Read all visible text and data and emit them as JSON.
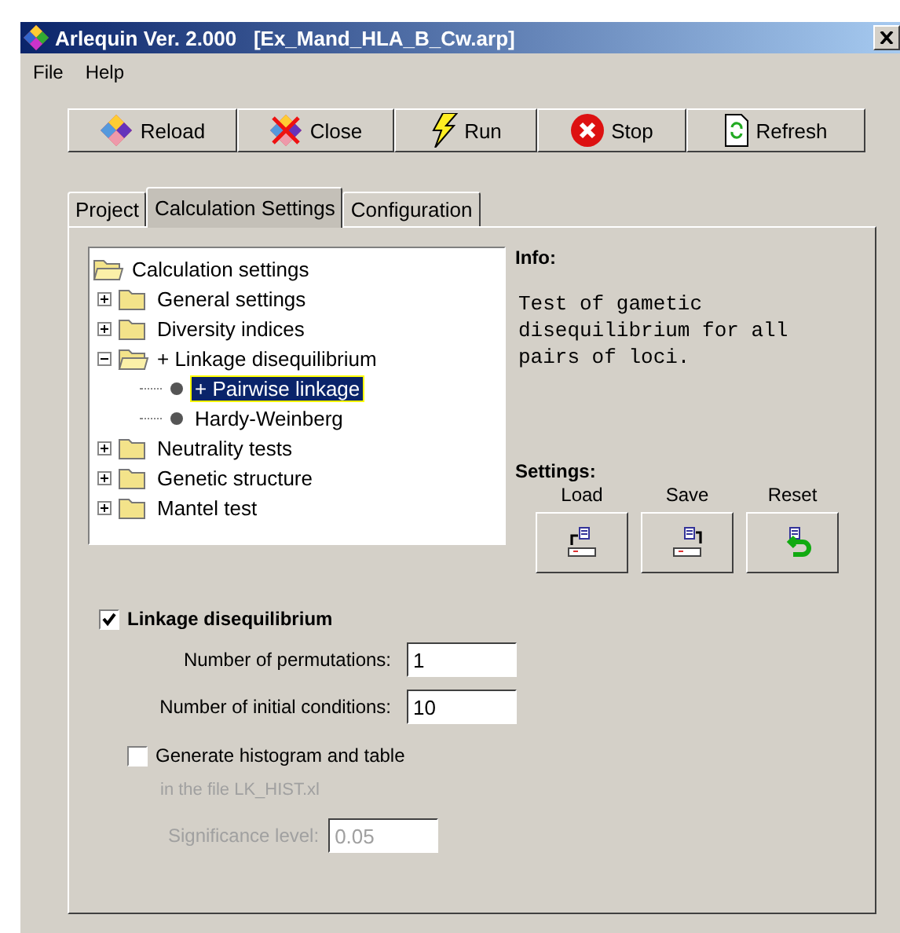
{
  "window": {
    "title": "Arlequin Ver. 2.000   [Ex_Mand_HLA_B_Cw.arp]"
  },
  "menu": [
    "File",
    "Help"
  ],
  "toolbar": [
    {
      "label": "Reload",
      "kind": "reload"
    },
    {
      "label": "Close",
      "kind": "close"
    },
    {
      "label": "Run",
      "kind": "run"
    },
    {
      "label": "Stop",
      "kind": "stop"
    },
    {
      "label": "Refresh",
      "kind": "refresh"
    }
  ],
  "tabs": [
    {
      "label": "Project",
      "selected": false
    },
    {
      "label": "Calculation Settings",
      "selected": true
    },
    {
      "label": "Configuration",
      "selected": false
    }
  ],
  "tree": {
    "label": "Calculation settings",
    "expanded": true,
    "children": [
      {
        "label": "General settings",
        "expanded": false,
        "selected": false
      },
      {
        "label": "Diversity indices",
        "expanded": false,
        "selected": false
      },
      {
        "label": "+ Linkage disequilibrium",
        "expanded": true,
        "selected": false,
        "children": [
          {
            "label": "+ Pairwise linkage",
            "selected": true
          },
          {
            "label": "Hardy-Weinberg",
            "selected": false
          }
        ]
      },
      {
        "label": "Neutrality tests",
        "expanded": false,
        "selected": false
      },
      {
        "label": "Genetic structure",
        "expanded": false,
        "selected": false
      },
      {
        "label": "Mantel test",
        "expanded": false,
        "selected": false
      }
    ]
  },
  "info": {
    "heading": "Info:",
    "text": "Test of gametic disequilibrium for all pairs of loci."
  },
  "settings": {
    "heading": "Settings:",
    "buttons": [
      {
        "label": "Load",
        "kind": "load"
      },
      {
        "label": "Save",
        "kind": "save"
      },
      {
        "label": "Reset",
        "kind": "reset"
      }
    ]
  },
  "linkage": {
    "label": "Linkage disequilibrium",
    "checked": true
  },
  "fields": [
    {
      "label": "Number of permutations:",
      "value": "1"
    },
    {
      "label": "Number of initial conditions:",
      "value": "10"
    }
  ],
  "histogram": {
    "label": "Generate histogram and table",
    "checked": false,
    "note": "in the file LK_HIST.xl"
  },
  "significance": {
    "label": "Significance level:",
    "value": "0.05",
    "disabled": true
  }
}
